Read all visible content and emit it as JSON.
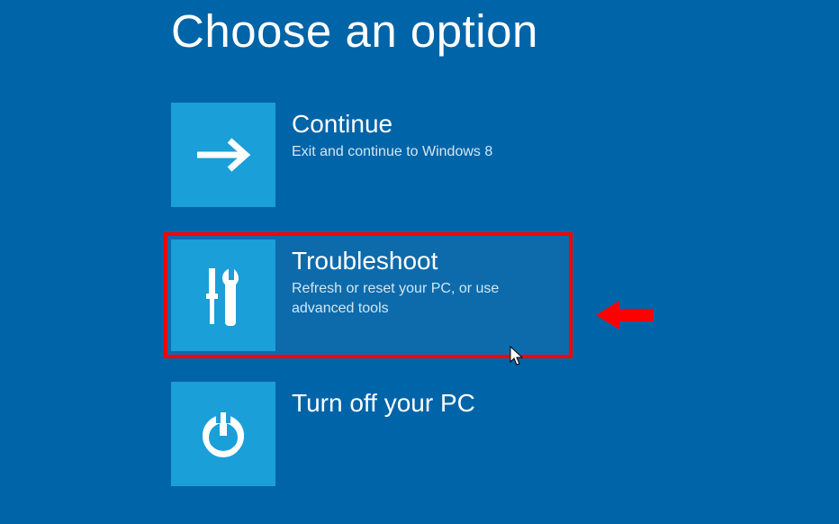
{
  "title": "Choose an option",
  "options": [
    {
      "icon": "arrow-right-icon",
      "title": "Continue",
      "description": "Exit and continue to Windows 8",
      "highlighted": false
    },
    {
      "icon": "tools-icon",
      "title": "Troubleshoot",
      "description": "Refresh or reset your PC, or use advanced tools",
      "highlighted": true
    },
    {
      "icon": "power-icon",
      "title": "Turn off your PC",
      "description": "",
      "highlighted": false
    }
  ],
  "colors": {
    "background": "#0064a8",
    "tile": "#1a9fd8",
    "annotation": "#ff0000"
  }
}
